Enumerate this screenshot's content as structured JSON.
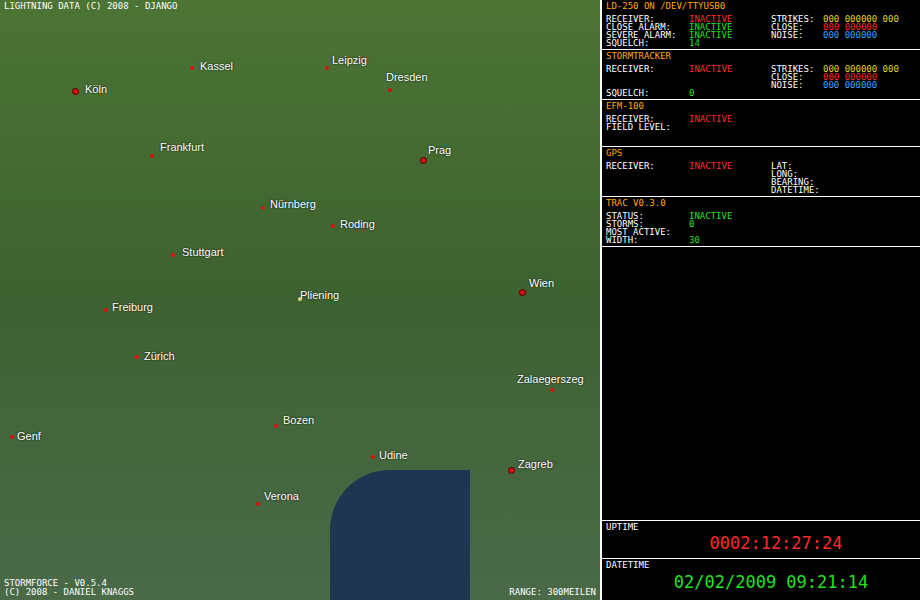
{
  "map": {
    "credit": "LIGHTNING DATA (C) 2008 - DJANGO",
    "app_name": "STORMFORCE - V0.5.4",
    "copyright": "(C) 2008 - DANIEL KNAGGS",
    "range": "RANGE: 300MEILEN",
    "cities": [
      {
        "name": "Köln",
        "kind": "capital"
      },
      {
        "name": "Kassel",
        "kind": "city"
      },
      {
        "name": "Leipzig",
        "kind": "city"
      },
      {
        "name": "Dresden",
        "kind": "city"
      },
      {
        "name": "Frankfurt",
        "kind": "city"
      },
      {
        "name": "Prag",
        "kind": "capital"
      },
      {
        "name": "Nürnberg",
        "kind": "city"
      },
      {
        "name": "Roding",
        "kind": "city"
      },
      {
        "name": "Stuttgart",
        "kind": "city"
      },
      {
        "name": "Wien",
        "kind": "capital"
      },
      {
        "name": "Pliening",
        "kind": "home"
      },
      {
        "name": "Freiburg",
        "kind": "city"
      },
      {
        "name": "Zürich",
        "kind": "city"
      },
      {
        "name": "Zalaegerszeg",
        "kind": "city"
      },
      {
        "name": "Genf",
        "kind": "city"
      },
      {
        "name": "Bozen",
        "kind": "city"
      },
      {
        "name": "Udine",
        "kind": "city"
      },
      {
        "name": "Zagreb",
        "kind": "capital"
      },
      {
        "name": "Verona",
        "kind": "city"
      }
    ]
  },
  "sections": [
    {
      "title": "LD-250 ON /DEV/TTYUSB0",
      "left": [
        {
          "label": "RECEIVER:",
          "value": "INACTIVE",
          "color": "#ff2a2a"
        },
        {
          "label": "CLOSE ALARM:",
          "value": "INACTIVE",
          "color": "#22e022"
        },
        {
          "label": "SEVERE ALARM:",
          "value": "INACTIVE",
          "color": "#22e022"
        },
        {
          "label": "SQUELCH:",
          "value": "14",
          "color": "#22e022"
        }
      ],
      "right": [
        {
          "label": "STRIKES:",
          "value": "000 000000 000",
          "color": "#e8d21a"
        },
        {
          "label": "CLOSE:",
          "value": "000 000000",
          "color": "#ff2a2a"
        },
        {
          "label": "NOISE:",
          "value": "000 000000",
          "color": "#3aa0ff"
        }
      ]
    },
    {
      "title": "STORMTRACKER",
      "left": [
        {
          "label": "RECEIVER:",
          "value": "INACTIVE",
          "color": "#ff2a2a"
        },
        {
          "label": "",
          "value": "",
          "color": "#ffffff"
        },
        {
          "label": "",
          "value": "",
          "color": "#ffffff"
        },
        {
          "label": "SQUELCH:",
          "value": "0",
          "color": "#22e022"
        }
      ],
      "right": [
        {
          "label": "STRIKES:",
          "value": "000 000000 000",
          "color": "#e8d21a"
        },
        {
          "label": "CLOSE:",
          "value": "000 000000",
          "color": "#ff2a2a"
        },
        {
          "label": "NOISE:",
          "value": "000 000000",
          "color": "#3aa0ff"
        }
      ]
    },
    {
      "title": "EFM-100",
      "left": [
        {
          "label": "RECEIVER:",
          "value": "INACTIVE",
          "color": "#ff2a2a"
        },
        {
          "label": "FIELD LEVEL:",
          "value": "",
          "color": "#22e022"
        }
      ],
      "right": []
    },
    {
      "title": "GPS",
      "left": [
        {
          "label": "RECEIVER:",
          "value": "INACTIVE",
          "color": "#ff2a2a"
        }
      ],
      "right": [
        {
          "label": "LAT:",
          "value": "",
          "color": "#ffffff"
        },
        {
          "label": "LONG:",
          "value": "",
          "color": "#ffffff"
        },
        {
          "label": "BEARING:",
          "value": "",
          "color": "#ffffff"
        },
        {
          "label": "DATETIME:",
          "value": "",
          "color": "#ffffff"
        }
      ]
    },
    {
      "title": "TRAC V0.3.0",
      "left": [
        {
          "label": "STATUS:",
          "value": "INACTIVE",
          "color": "#22e022"
        },
        {
          "label": "STORMS:",
          "value": "0",
          "color": "#22e022"
        },
        {
          "label": "MOST ACTIVE:",
          "value": "",
          "color": "#22e022"
        },
        {
          "label": "WIDTH:",
          "value": "30",
          "color": "#22e022"
        }
      ],
      "right": []
    }
  ],
  "uptime": {
    "label": "UPTIME",
    "value": "0002:12:27:24",
    "color": "#ff2a2a"
  },
  "datetime": {
    "label": "DATETIME",
    "value": "02/02/2009 09:21:14",
    "color": "#22e022"
  }
}
